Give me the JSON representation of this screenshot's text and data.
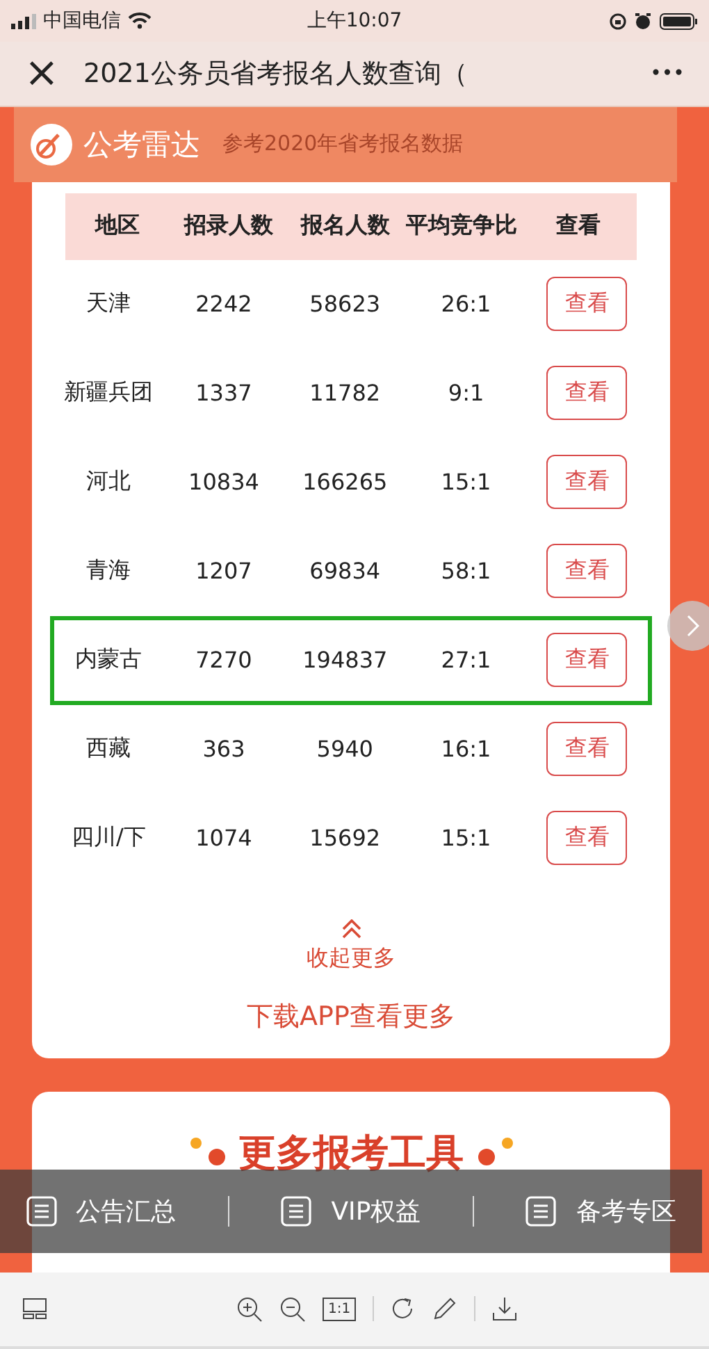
{
  "status_bar": {
    "carrier": "中国电信",
    "time": "上午10:07"
  },
  "nav": {
    "close": "×",
    "title": "2021公务员省考报名人数查询（",
    "more": "•••"
  },
  "banner": {
    "brand": "公考雷达",
    "subtitle": "参考2020年省考报名数据"
  },
  "table": {
    "columns": [
      "地区",
      "招录人数",
      "报名人数",
      "平均竞争比",
      "查看"
    ],
    "rows": [
      {
        "cells": [
          "天津",
          "2242",
          "58623",
          "26:1"
        ],
        "action": "查看",
        "selected": false
      },
      {
        "cells": [
          "新疆兵团",
          "1337",
          "11782",
          "9:1"
        ],
        "action": "查看",
        "selected": false
      },
      {
        "cells": [
          "河北",
          "10834",
          "166265",
          "15:1"
        ],
        "action": "查看",
        "selected": false
      },
      {
        "cells": [
          "青海",
          "1207",
          "69834",
          "58:1"
        ],
        "action": "查看",
        "selected": false
      },
      {
        "cells": [
          "内蒙古",
          "7270",
          "194837",
          "27:1"
        ],
        "action": "查看",
        "selected": true
      },
      {
        "cells": [
          "西藏",
          "363",
          "5940",
          "16:1"
        ],
        "action": "查看",
        "selected": false
      },
      {
        "cells": [
          "四川/下",
          "1074",
          "15692",
          "15:1"
        ],
        "action": "查看",
        "selected": false
      }
    ]
  },
  "collapse": "收起更多",
  "download": "下载APP查看更多",
  "tools_title": "更多报考工具",
  "quick_bar": [
    "公告汇总",
    "VIP权益",
    "备考专区"
  ],
  "viewer_toolbar": {
    "actual_size": "1:1"
  }
}
